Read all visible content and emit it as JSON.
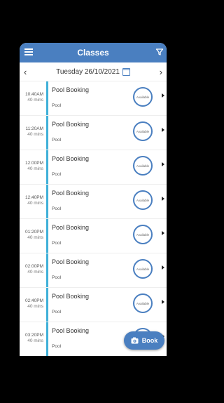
{
  "appbar": {
    "title": "Classes",
    "menu_icon": "menu-icon",
    "filter_icon": "filter-icon"
  },
  "datebar": {
    "date": "Tuesday 26/10/2021",
    "prev_icon": "chevron-left-icon",
    "next_icon": "chevron-right-icon",
    "calendar_icon": "calendar-icon"
  },
  "classes": [
    {
      "time": "10:40AM",
      "duration": "40 mins",
      "name": "Pool Booking",
      "location": "Pool",
      "status": "Available"
    },
    {
      "time": "11:20AM",
      "duration": "40 mins",
      "name": "Pool Booking",
      "location": "Pool",
      "status": "Available"
    },
    {
      "time": "12:00PM",
      "duration": "40 mins",
      "name": "Pool Booking",
      "location": "Pool",
      "status": "Available"
    },
    {
      "time": "12:40PM",
      "duration": "40 mins",
      "name": "Pool Booking",
      "location": "Pool",
      "status": "Available"
    },
    {
      "time": "01:20PM",
      "duration": "40 mins",
      "name": "Pool Booking",
      "location": "Pool",
      "status": "Available"
    },
    {
      "time": "02:00PM",
      "duration": "40 mins",
      "name": "Pool Booking",
      "location": "Pool",
      "status": "Available"
    },
    {
      "time": "02:40PM",
      "duration": "40 mins",
      "name": "Pool Booking",
      "location": "Pool",
      "status": "Available"
    },
    {
      "time": "03:20PM",
      "duration": "40 mins",
      "name": "Pool Booking",
      "location": "Pool",
      "status": "Available"
    }
  ],
  "fab": {
    "label": "Book",
    "icon": "book-camera-icon"
  },
  "colors": {
    "primary": "#4a7fc0",
    "accent_bar": "#3fb0d8"
  }
}
